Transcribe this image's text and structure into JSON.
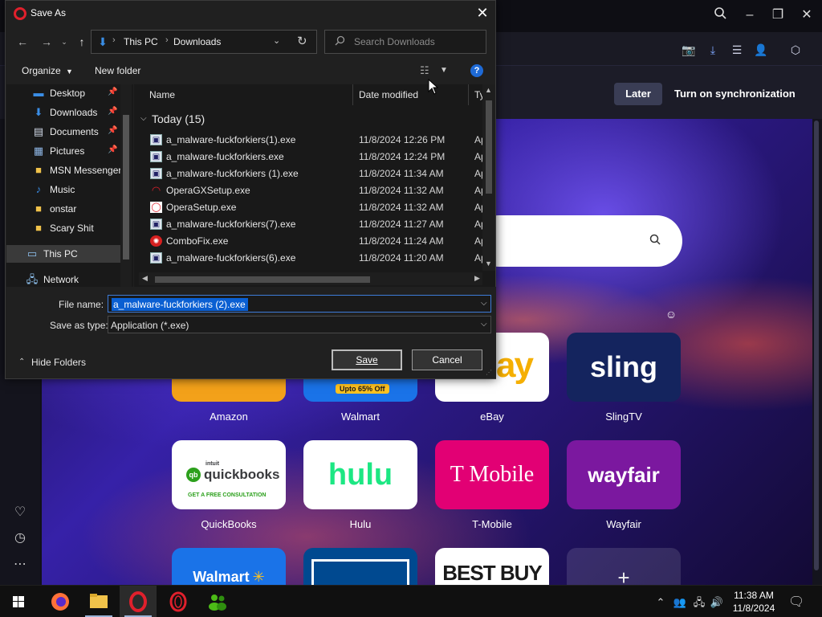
{
  "browser": {
    "sync_later_label": "Later",
    "sync_turn_on_label": "Turn on synchronization",
    "speed_dial": [
      {
        "label": "Amazon",
        "tile_text": ""
      },
      {
        "label": "Walmart",
        "tile_text": "Upto 65% Off"
      },
      {
        "label": "eBay",
        "tile_text": "ay"
      },
      {
        "label": "SlingTV",
        "tile_text": "sling"
      },
      {
        "label": "QuickBooks",
        "tile_text": "quickbooks",
        "tile_badge": "intuit",
        "tile_sub": "GET A FREE CONSULTATION"
      },
      {
        "label": "Hulu",
        "tile_text": "hulu"
      },
      {
        "label": "T-Mobile",
        "tile_text": "T Mobile"
      },
      {
        "label": "Wayfair",
        "tile_text": "wayfair"
      },
      {
        "label": "",
        "tile_text": "Walmart"
      },
      {
        "label": "",
        "tile_text": ""
      },
      {
        "label": "",
        "tile_text": "BEST BUY"
      },
      {
        "label": "",
        "tile_text": "+"
      }
    ],
    "colors": {
      "amazon": "#f3a11a",
      "walmart": "#1a73e8",
      "sling": "#14245e",
      "tmobile": "#e20074",
      "wayfair": "#7b189f",
      "lowes": "#004990"
    }
  },
  "dialog": {
    "title": "Save As",
    "path": [
      "This PC",
      "Downloads"
    ],
    "search_placeholder": "Search Downloads",
    "toolbar": {
      "organize": "Organize",
      "new_folder": "New folder"
    },
    "nav_items": [
      {
        "label": "Desktop",
        "icon": "desktop-icon",
        "pinned": true
      },
      {
        "label": "Downloads",
        "icon": "downloads-icon",
        "pinned": true
      },
      {
        "label": "Documents",
        "icon": "documents-icon",
        "pinned": true
      },
      {
        "label": "Pictures",
        "icon": "pictures-icon",
        "pinned": true
      },
      {
        "label": "MSN Messenger",
        "icon": "folder-icon",
        "pinned": false
      },
      {
        "label": "Music",
        "icon": "music-icon",
        "pinned": false
      },
      {
        "label": "onstar",
        "icon": "folder-icon",
        "pinned": false
      },
      {
        "label": "Scary Shit",
        "icon": "folder-icon",
        "pinned": false
      },
      {
        "label": "This PC",
        "icon": "this-pc-icon",
        "pinned": false
      },
      {
        "label": "Network",
        "icon": "network-icon",
        "pinned": false
      }
    ],
    "columns": {
      "name": "Name",
      "date": "Date modified",
      "type": "Ty"
    },
    "group_label": "Today (15)",
    "files": [
      {
        "name": "a_malware-fuckforkiers(1).exe",
        "date": "11/8/2024 12:26 PM",
        "type": "Ap",
        "icon": "exe-icon"
      },
      {
        "name": "a_malware-fuckforkiers.exe",
        "date": "11/8/2024 12:24 PM",
        "type": "Ap",
        "icon": "exe-icon"
      },
      {
        "name": "a_malware-fuckforkiers (1).exe",
        "date": "11/8/2024 11:34 AM",
        "type": "Ap",
        "icon": "exe-icon"
      },
      {
        "name": "OperaGXSetup.exe",
        "date": "11/8/2024 11:32 AM",
        "type": "Ap",
        "icon": "opera-gx-icon"
      },
      {
        "name": "OperaSetup.exe",
        "date": "11/8/2024 11:32 AM",
        "type": "Ap",
        "icon": "opera-icon"
      },
      {
        "name": "a_malware-fuckforkiers(7).exe",
        "date": "11/8/2024 11:27 AM",
        "type": "Ap",
        "icon": "exe-icon"
      },
      {
        "name": "ComboFix.exe",
        "date": "11/8/2024 11:24 AM",
        "type": "Ap",
        "icon": "combofix-icon"
      },
      {
        "name": "a_malware-fuckforkiers(6).exe",
        "date": "11/8/2024 11:20 AM",
        "type": "Ap",
        "icon": "exe-icon"
      }
    ],
    "file_name_label": "File name:",
    "file_name_value": "a_malware-fuckforkiers (2).exe",
    "save_type_label": "Save as type:",
    "save_type_value": "Application (*.exe)",
    "hide_folders": "Hide Folders",
    "save_label": "Save",
    "cancel_label": "Cancel"
  },
  "taskbar": {
    "time": "11:38 AM",
    "date": "11/8/2024"
  }
}
